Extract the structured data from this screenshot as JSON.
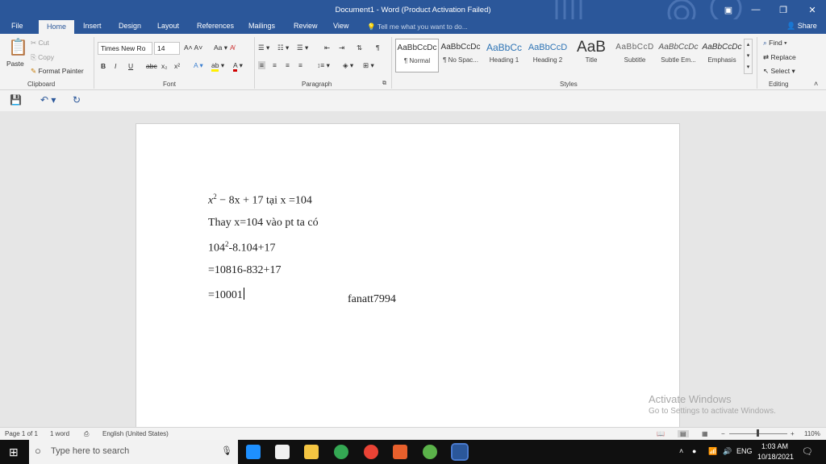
{
  "window": {
    "title": "Document1 - Word (Product Activation Failed)"
  },
  "tabs": [
    "File",
    "Home",
    "Insert",
    "Design",
    "Layout",
    "References",
    "Mailings",
    "Review",
    "View"
  ],
  "tell_me": "Tell me what you want to do...",
  "share": "Share",
  "clipboard": {
    "paste": "Paste",
    "cut": "Cut",
    "copy": "Copy",
    "format_painter": "Format Painter",
    "label": "Clipboard"
  },
  "font": {
    "name": "Times New Ro",
    "size": "14",
    "label": "Font",
    "aa": "Aa",
    "bold": "B",
    "italic": "I",
    "underline": "U",
    "strike": "abc",
    "sub": "x₂",
    "sup": "x²"
  },
  "paragraph": {
    "label": "Paragraph"
  },
  "styles": {
    "label": "Styles",
    "items": [
      {
        "preview": "AaBbCcDc",
        "name": "¶ Normal"
      },
      {
        "preview": "AaBbCcDc",
        "name": "¶ No Spac..."
      },
      {
        "preview": "AaBbCc",
        "name": "Heading 1"
      },
      {
        "preview": "AaBbCcD",
        "name": "Heading 2"
      },
      {
        "preview": "AaB",
        "name": "Title"
      },
      {
        "preview": "AaBbCcD",
        "name": "Subtitle"
      },
      {
        "preview": "AaBbCcDc",
        "name": "Subtle Em..."
      },
      {
        "preview": "AaBbCcDc",
        "name": "Emphasis"
      }
    ]
  },
  "editing": {
    "find": "Find",
    "replace": "Replace",
    "select": "Select",
    "label": "Editing"
  },
  "document": {
    "line1_var": "x",
    "line1_exp": "2",
    "line1_rest": " − 8x + 17 tại x =104",
    "line2": "Thay x=104 vào pt ta có",
    "line3_base": "104",
    "line3_exp": "2",
    "line3_rest": "-8.104+17",
    "line4": "=10816-832+17",
    "line5": "=10001",
    "watermark": "fanatt7994"
  },
  "activation": {
    "line1": "Activate Windows",
    "line2": "Go to Settings to activate Windows."
  },
  "status": {
    "page": "Page 1 of 1",
    "words": "1 word",
    "language": "English (United States)",
    "zoom": "110%"
  },
  "taskbar": {
    "search_placeholder": "Type here to search",
    "lang": "ENG",
    "time": "1:03 AM",
    "date": "10/18/2021"
  }
}
